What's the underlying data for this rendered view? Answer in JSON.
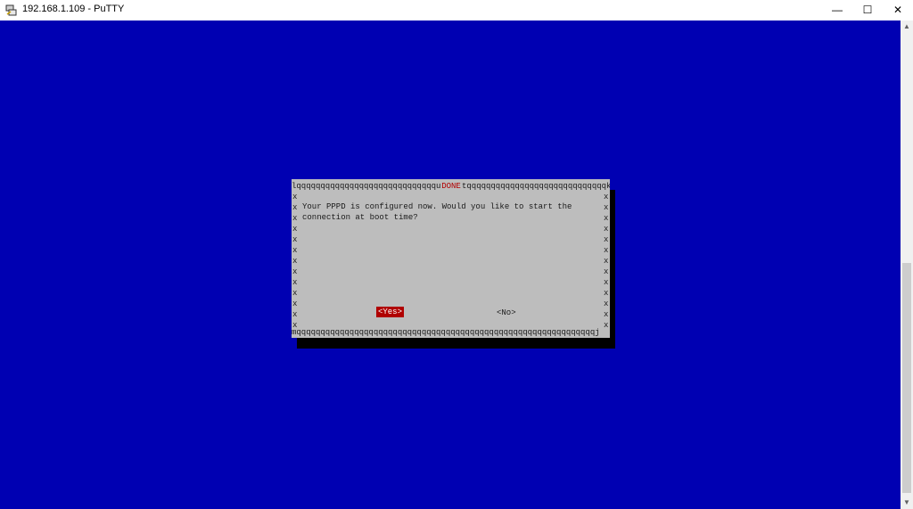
{
  "window": {
    "title": "192.168.1.109 - PuTTY",
    "controls": {
      "minimize": "—",
      "maximize": "☐",
      "close": "✕"
    }
  },
  "dialog": {
    "title": "DONE",
    "border_top_left": "lqqqqqqqqqqqqqqqqqqqqqqqqqqqqqu",
    "border_top_right": "tqqqqqqqqqqqqqqqqqqqqqqqqqqqqqk",
    "border_bottom": "mqqqqqqqqqqqqqqqqqqqqqqqqqqqqqqqqqqqqqqqqqqqqqqqqqqqqqqqqqqqqqqj",
    "side_char": "x",
    "message_line1": "Your PPPD is configured now. Would you like to start the",
    "message_line2": "connection at boot time?",
    "yes_label": "<Yes>",
    "no_label": "<No>"
  },
  "colors": {
    "terminal_bg": "#0000b2",
    "dialog_bg": "#bdbdbd",
    "accent_red": "#b00000"
  },
  "icons": {
    "app": "putty-icon"
  }
}
